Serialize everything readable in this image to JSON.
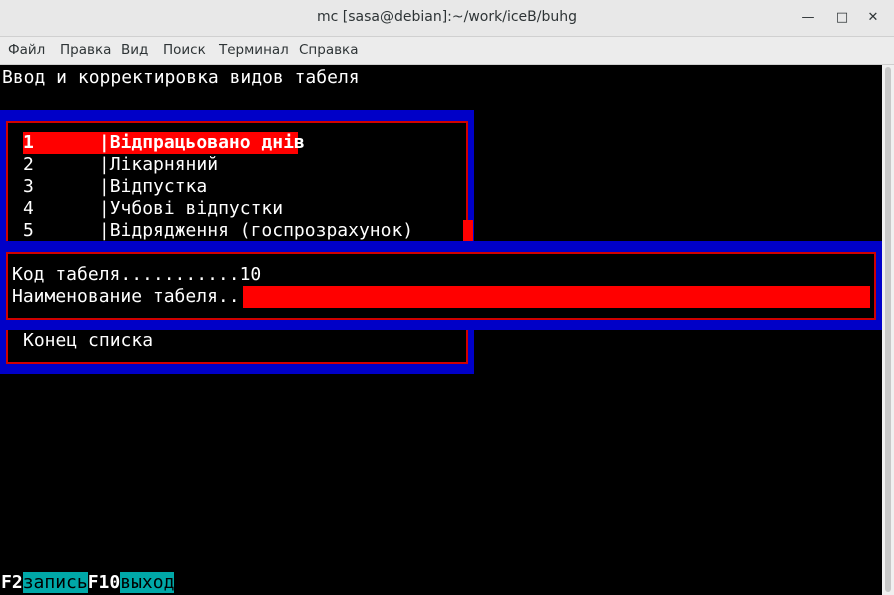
{
  "window": {
    "title": "mc [sasa@debian]:~/work/iceB/buhg"
  },
  "menu": [
    "Файл",
    "Правка",
    "Вид",
    "Поиск",
    "Терминал",
    "Справка"
  ],
  "header": "Ввод и корректировка видов табеля",
  "list": {
    "rows": [
      {
        "num": "1",
        "name": "Відпрацьовано днів"
      },
      {
        "num": "2",
        "name": "Лікарняний"
      },
      {
        "num": "3",
        "name": "Відпустка"
      },
      {
        "num": "4",
        "name": "Учбові відпустки"
      },
      {
        "num": "5",
        "name": "Відрядження (госпрозрахунок)"
      }
    ],
    "end": "Конец списка"
  },
  "form": {
    "code_label": "Код табеля...........",
    "code_value": "10",
    "name_label": "Наименование табеля..",
    "name_value": ""
  },
  "footer": {
    "f2_key": "F2",
    "f2_label": "запись",
    "f10_key": "F10",
    "f10_label": "выход"
  },
  "colors": {
    "highlight": "#ff0000",
    "panel": "#0000c8",
    "fkey_bg": "#00a8a8"
  }
}
